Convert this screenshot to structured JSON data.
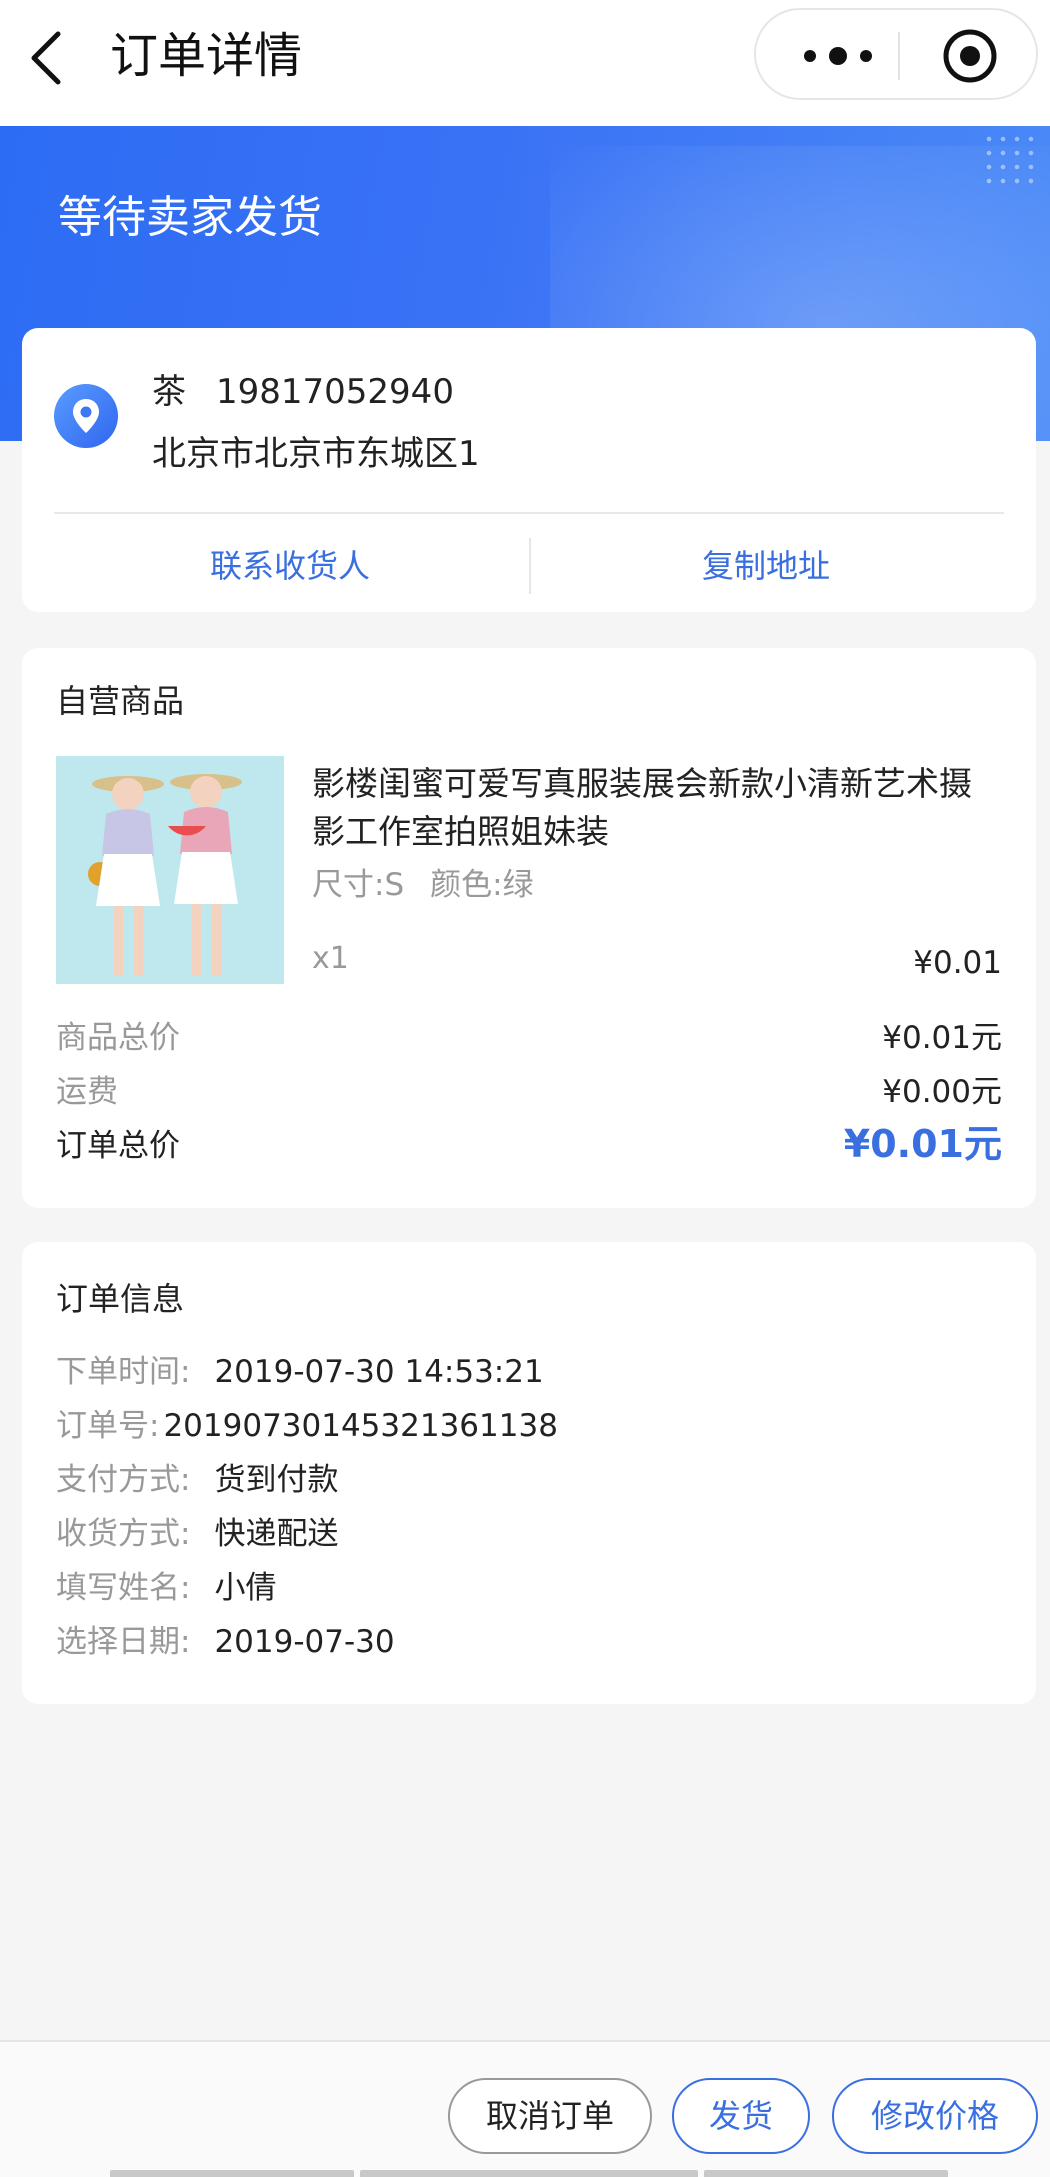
{
  "nav": {
    "title": "订单详情",
    "back_icon": "chevron-left-icon",
    "more_icon": "more-dots-icon",
    "target_icon": "target-circle-icon"
  },
  "banner": {
    "status": "等待卖家发货",
    "accent_color": "#2c6cf4"
  },
  "address": {
    "name": "茶",
    "phone": "19817052940",
    "detail": "北京市北京市东城区1",
    "contact_label": "联系收货人",
    "copy_label": "复制地址",
    "icon": "location-pin-icon"
  },
  "goods": {
    "section_title": "自营商品",
    "item": {
      "name": "影楼闺蜜可爱写真服装展会新款小清新艺术摄影工作室拍照姐妹装",
      "size": "尺寸:S",
      "color": "颜色:绿",
      "qty": "x1",
      "price": "¥0.01"
    },
    "summary": {
      "goods_total_label": "商品总价",
      "goods_total_value": "¥0.01元",
      "shipping_label": "运费",
      "shipping_value": "¥0.00元",
      "order_total_label": "订单总价",
      "order_total_value": "¥0.01元"
    }
  },
  "order_info": {
    "section_title": "订单信息",
    "rows": [
      {
        "label": "下单时间:",
        "value": "2019-07-30 14:53:21"
      },
      {
        "label": "订单号:",
        "value": "20190730145321361138"
      },
      {
        "label": "支付方式:",
        "value": "货到付款"
      },
      {
        "label": "收货方式:",
        "value": "快递配送"
      },
      {
        "label": "填写姓名:",
        "value": "小倩"
      },
      {
        "label": "选择日期:",
        "value": "2019-07-30"
      }
    ]
  },
  "actions": {
    "cancel_label": "取消订单",
    "ship_label": "发货",
    "modify_label": "修改价格"
  },
  "colors": {
    "primary": "#3a6fe0",
    "muted_text": "#999999"
  }
}
